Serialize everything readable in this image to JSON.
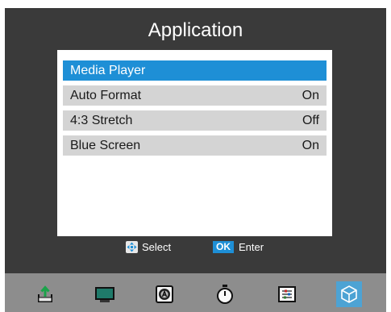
{
  "header": {
    "title": "Application"
  },
  "menu": {
    "items": [
      {
        "label": "Media Player",
        "value": ""
      },
      {
        "label": "Auto Format",
        "value": "On"
      },
      {
        "label": "4:3 Stretch",
        "value": "Off"
      },
      {
        "label": "Blue Screen",
        "value": "On"
      }
    ],
    "selected_index": 0
  },
  "hints": {
    "select_label": "Select",
    "ok_key": "OK",
    "enter_label": "Enter"
  },
  "bottom_bar": {
    "icons": [
      "export-icon",
      "monitor-icon",
      "audio-speaker-icon",
      "timer-icon",
      "list-settings-icon",
      "cube-icon"
    ],
    "active_icon": "cube-icon"
  },
  "colors": {
    "screen_background": "#3a3a3a",
    "highlight": "#1e8fd6",
    "row": "#d4d4d4",
    "bottom_bar": "#8d8d8d",
    "active_tab": "#4da3d4"
  }
}
